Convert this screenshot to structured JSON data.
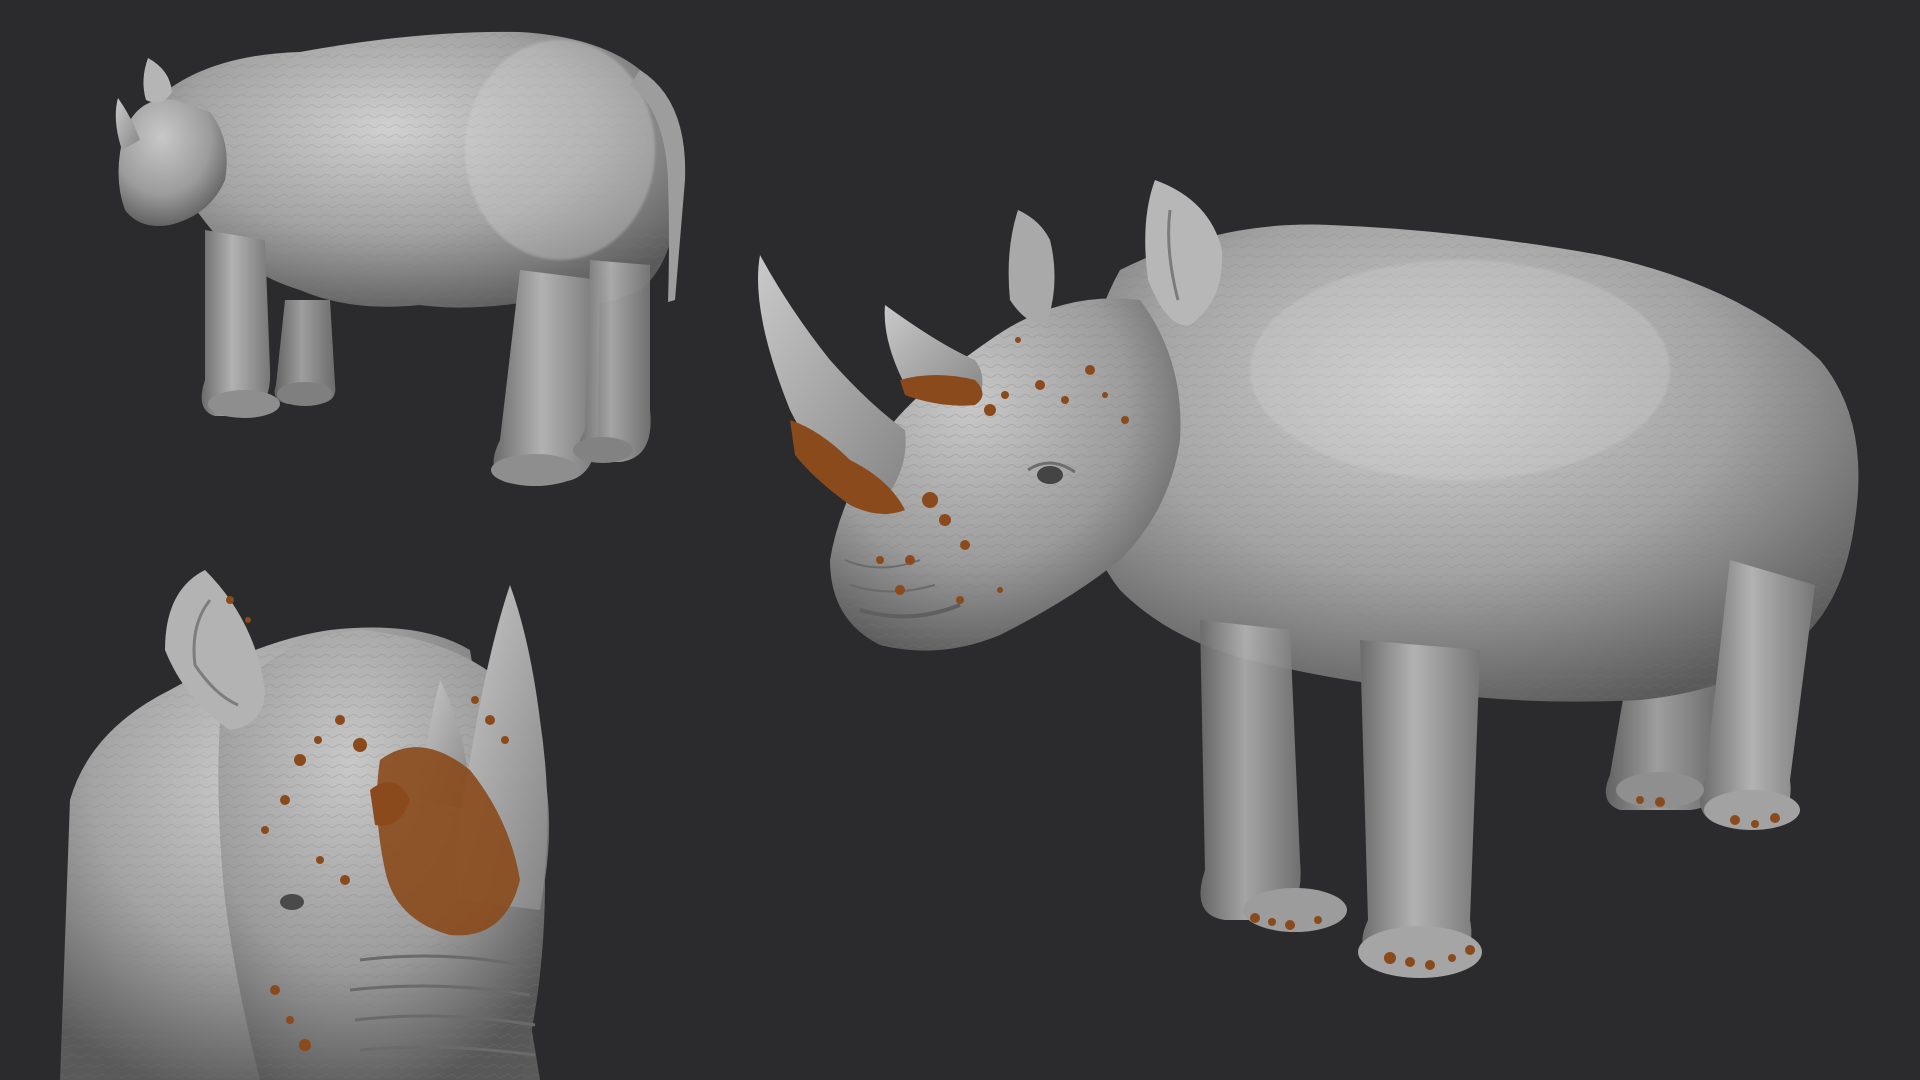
{
  "scene": {
    "background_color": "#2b2b2d",
    "clay_color": "#a8a8a8",
    "clay_light": "#cfcfcf",
    "clay_dark": "#5e5e5e",
    "mud_color": "#8a4a1c",
    "mud_dark": "#5c2d0e"
  },
  "views": [
    {
      "name": "rear-three-quarter-view",
      "subject": "rhino-sculpt"
    },
    {
      "name": "front-close-up-view",
      "subject": "rhino-sculpt"
    },
    {
      "name": "side-three-quarter-view",
      "subject": "rhino-sculpt"
    }
  ]
}
